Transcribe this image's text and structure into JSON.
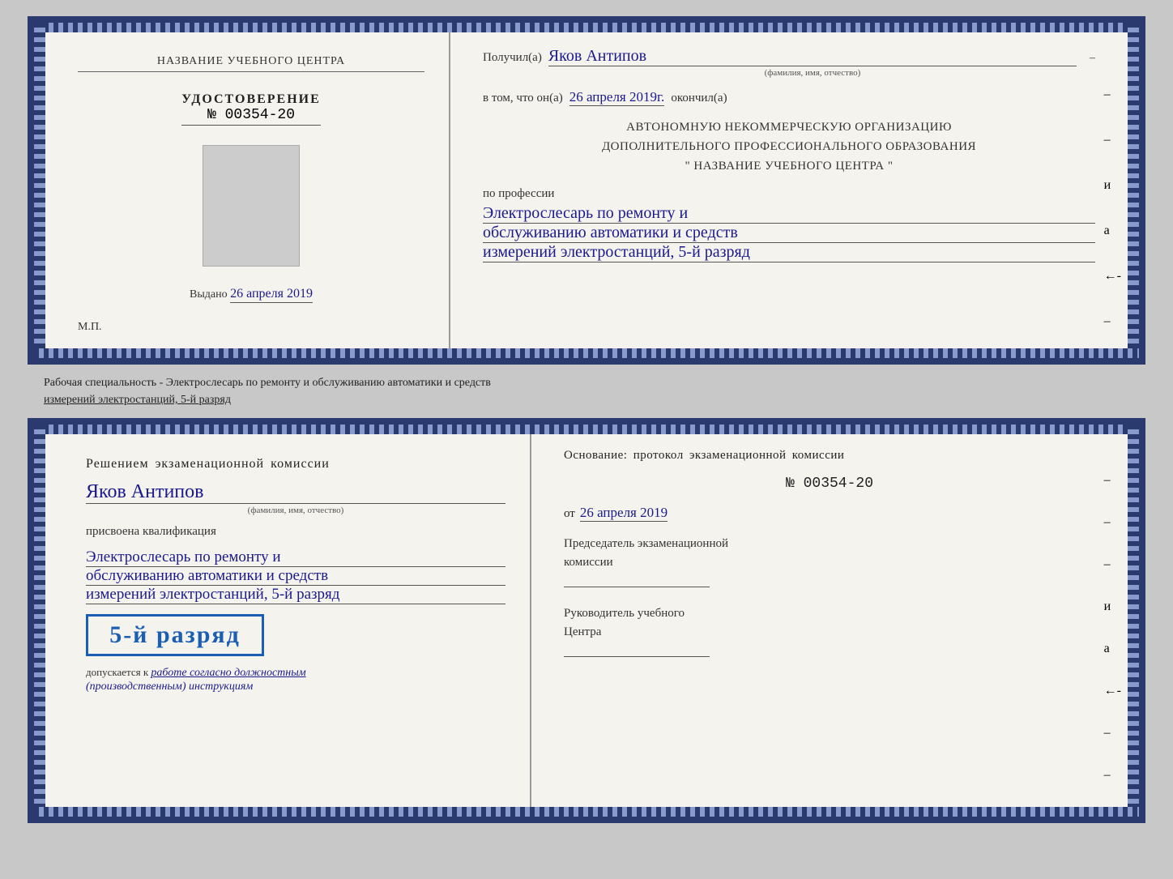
{
  "cert_top": {
    "left": {
      "school_name": "НАЗВАНИЕ УЧЕБНОГО ЦЕНТРА",
      "cert_title": "УДОСТОВЕРЕНИЕ",
      "cert_number": "№ 00354-20",
      "issued_label": "Выдано",
      "issued_date": "26 апреля 2019",
      "mp": "М.П."
    },
    "right": {
      "recipient_label": "Получил(а)",
      "recipient_name": "Яков Антипов",
      "recipient_caption": "(фамилия, имя, отчество)",
      "vtom_label": "в том, что он(а)",
      "vtom_date": "26 апреля 2019г.",
      "okoncil_label": "окончил(а)",
      "org_line1": "АВТОНОМНУЮ НЕКОММЕРЧЕСКУЮ ОРГАНИЗАЦИЮ",
      "org_line2": "ДОПОЛНИТЕЛЬНОГО ПРОФЕССИОНАЛЬНОГО ОБРАЗОВАНИЯ",
      "org_line3": "\"   НАЗВАНИЕ УЧЕБНОГО ЦЕНТРА   \"",
      "profession_label": "по профессии",
      "profession_line1": "Электрослесарь по ремонту и",
      "profession_line2": "обслуживанию автоматики и средств",
      "profession_line3": "измерений электростанций, 5-й разряд"
    }
  },
  "separator": {
    "text": "Рабочая специальность - Электрослесарь по ремонту и обслуживанию автоматики и средств",
    "text2": "измерений электростанций, 5-й разряд"
  },
  "cert_bottom": {
    "left": {
      "decision_text": "Решением  экзаменационной  комиссии",
      "name": "Яков Антипов",
      "name_caption": "(фамилия, имя, отчество)",
      "assigned_label": "присвоена квалификация",
      "qual_line1": "Электрослесарь по ремонту и",
      "qual_line2": "обслуживанию автоматики и средств",
      "qual_line3": "измерений электростанций, 5-й разряд",
      "rank_badge": "5-й разряд",
      "допускается_label": "допускается к",
      "допускается_text": "работе согласно должностным",
      "инструкциям": "(производственным) инструкциям"
    },
    "right": {
      "osnov_label": "Основание:  протокол  экзаменационной  комиссии",
      "protocol_number": "№  00354-20",
      "protocol_date_prefix": "от",
      "protocol_date": "26 апреля 2019",
      "chairman_label": "Председатель экзаменационной",
      "chairman_label2": "комиссии",
      "rukovoditel_label": "Руководитель учебного",
      "rukovoditel_label2": "Центра"
    }
  }
}
